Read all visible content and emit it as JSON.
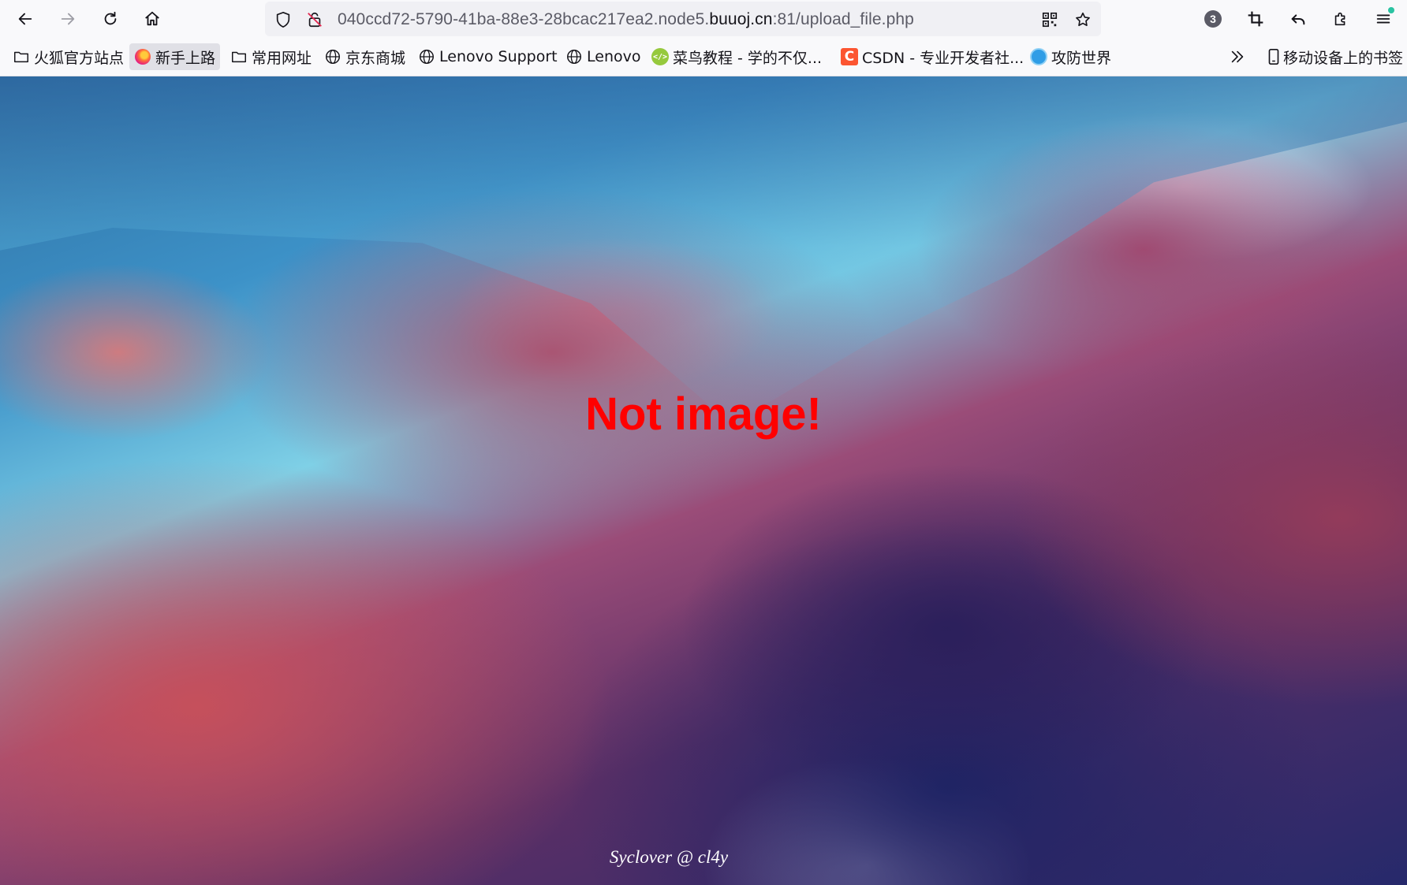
{
  "browser": {
    "url": {
      "prefix": "040ccd72-5790-41ba-88e3-28bcac217ea2.node5.",
      "domain": "buuoj.cn",
      "suffix": ":81/upload_file.php"
    },
    "extension_badge": "3"
  },
  "bookmarks": [
    {
      "label": "火狐官方站点",
      "icon": "folder-icon"
    },
    {
      "label": "新手上路",
      "icon": "firefox-icon"
    },
    {
      "label": "常用网址",
      "icon": "folder-icon"
    },
    {
      "label": "京东商城",
      "icon": "globe-icon"
    },
    {
      "label": "Lenovo Support",
      "icon": "globe-icon"
    },
    {
      "label": "Lenovo",
      "icon": "globe-icon"
    },
    {
      "label": "菜鸟教程 - 学的不仅...",
      "icon": "runoob-icon"
    },
    {
      "label": "CSDN - 专业开发者社...",
      "icon": "csdn-icon"
    },
    {
      "label": "攻防世界",
      "icon": "adworld-icon"
    },
    {
      "label": "移动设备上的书签",
      "icon": "mobile-icon"
    }
  ],
  "page": {
    "message": "Not image!",
    "footer": "Syclover @ cl4y",
    "message_color": "#ff0000"
  }
}
